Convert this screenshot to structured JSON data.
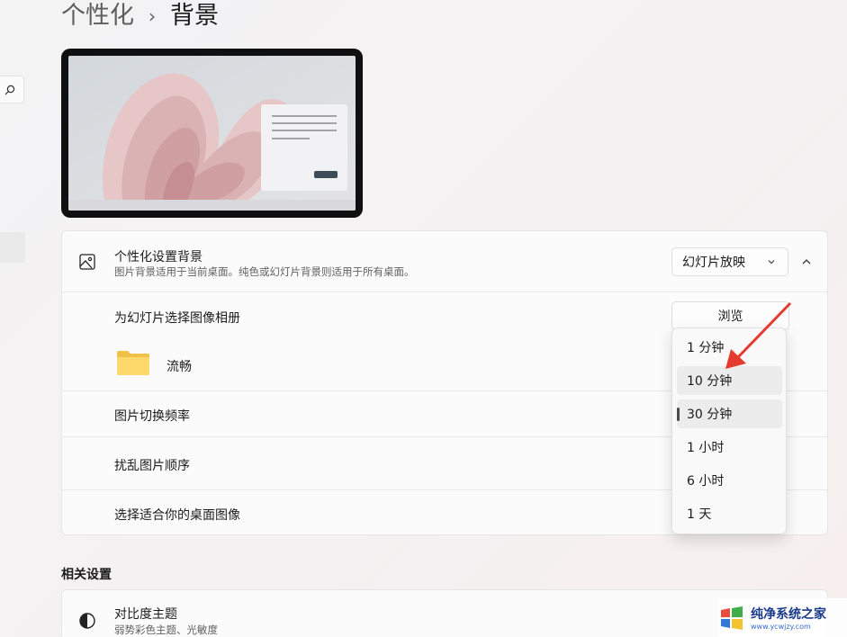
{
  "breadcrumb": {
    "parent": "个性化",
    "separator": "›",
    "current": "背景"
  },
  "personalize_card": {
    "title": "个性化设置背景",
    "description": "图片背景适用于当前桌面。纯色或幻灯片背景则适用于所有桌面。",
    "dropdown_value": "幻灯片放映",
    "album_label": "为幻灯片选择图像相册",
    "browse_label": "浏览",
    "folder_name": "流畅",
    "frequency_label": "图片切换频率",
    "shuffle_label": "扰乱图片顺序",
    "fit_label": "选择适合你的桌面图像"
  },
  "frequency_menu": {
    "options": [
      "1 分钟",
      "10 分钟",
      "30 分钟",
      "1 小时",
      "6 小时",
      "1 天"
    ],
    "selected": "30 分钟",
    "hovered": "10 分钟"
  },
  "related": {
    "title": "相关设置",
    "contrast_title": "对比度主题",
    "contrast_sub": "弱势彩色主题、光敏度"
  },
  "watermark": {
    "title": "纯净系统之家",
    "url": "www.ycwjzy.com"
  },
  "colors": {
    "annotation_arrow": "#e53a2f",
    "accent": "#4a4a4a"
  }
}
